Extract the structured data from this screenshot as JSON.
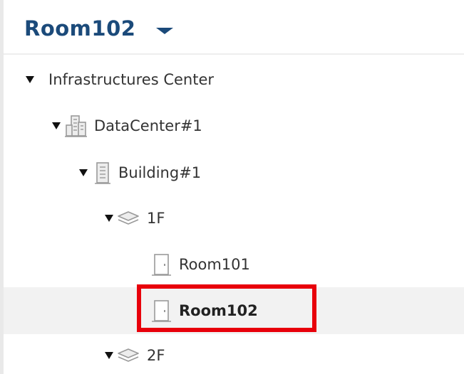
{
  "header": {
    "title": "Room102"
  },
  "tree": {
    "root": "Infrastructures Center",
    "datacenter": "DataCenter#1",
    "building": "Building#1",
    "floor1": "1F",
    "room101": "Room101",
    "room102": "Room102",
    "floor2": "2F"
  },
  "colors": {
    "accent": "#1b4a7a",
    "highlight": "#e8000b",
    "selected_bg": "#f2f2f2"
  },
  "icons": {
    "datacenter": "buildings-icon",
    "building": "building-icon",
    "floor": "layers-icon",
    "room": "door-icon"
  }
}
